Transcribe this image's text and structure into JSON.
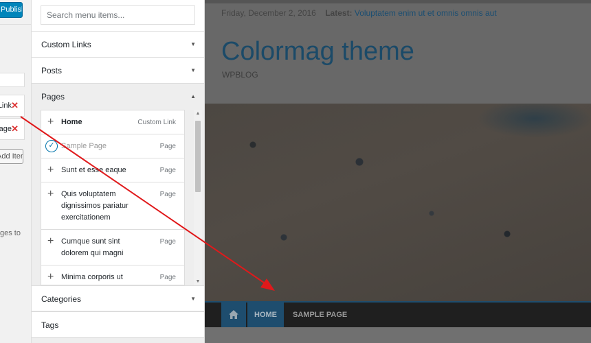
{
  "left_strip": {
    "publish_label": "Publish",
    "menu_items": [
      {
        "label": "Custom Link"
      },
      {
        "label": "Sample Page"
      }
    ],
    "add_items_label": "Add Items",
    "note_fragment": "ges to"
  },
  "panel": {
    "search_placeholder": "Search menu items...",
    "sections": [
      {
        "label": "Custom Links"
      },
      {
        "label": "Posts"
      },
      {
        "label": "Pages"
      },
      {
        "label": "Categories"
      },
      {
        "label": "Tags"
      }
    ],
    "pages": [
      {
        "title": "Home",
        "type": "Custom Link",
        "added": false
      },
      {
        "title": "Sample Page",
        "type": "Page",
        "added": true
      },
      {
        "title": "Sunt et esse eaque",
        "type": "Page",
        "added": false
      },
      {
        "title": "Quis voluptatem dignissimos pariatur exercitationem",
        "type": "Page",
        "added": false
      },
      {
        "title": "Cumque sunt sint dolorem qui magni",
        "type": "Page",
        "added": false
      },
      {
        "title": "Minima corporis ut temporibus quasi",
        "type": "Page",
        "added": false
      }
    ]
  },
  "preview": {
    "date": "Friday, December 2, 2016",
    "latest_label": "Latest:",
    "latest_headline": "Voluptatem enim ut et omnis omnis aut",
    "site_title": "Colormag theme",
    "tagline": "WPBLOG",
    "nav": [
      {
        "label": "HOME",
        "active": true
      },
      {
        "label": "SAMPLE PAGE",
        "active": false
      }
    ]
  },
  "colors": {
    "accent": "#0085ba",
    "remove": "#dc3232",
    "arrow": "#e0191b",
    "nav_active": "#1e4d6e"
  },
  "icons": {
    "home": "home-icon",
    "add": "plus-icon",
    "added": "check-icon",
    "remove": "close-icon"
  }
}
